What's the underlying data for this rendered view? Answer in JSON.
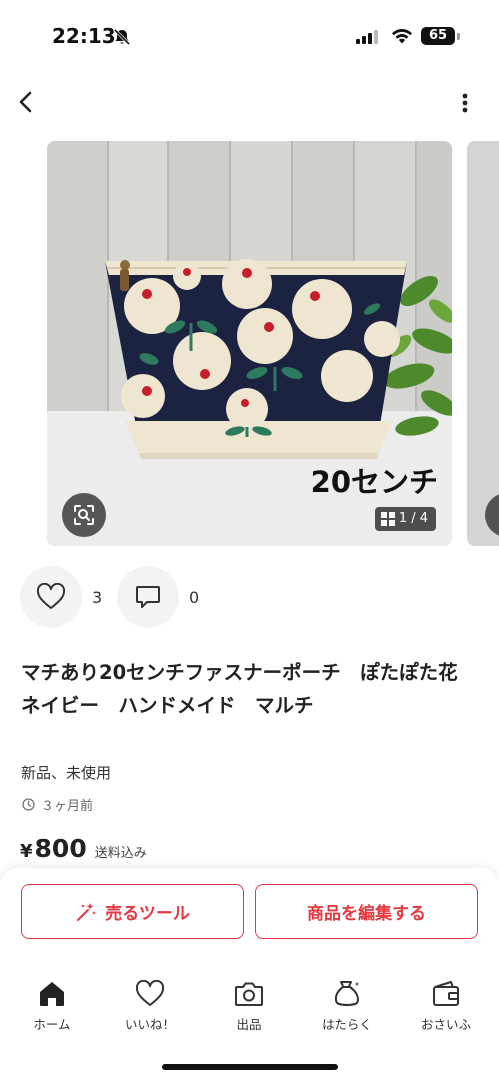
{
  "status_bar": {
    "time": "22:13",
    "battery": "65"
  },
  "product": {
    "image_overlay_text": "20センチ",
    "image_counter": "1 / 4",
    "likes": "3",
    "comments": "0",
    "title": "マチあり20センチファスナーポーチ　ぽたぽた花　ネイビー　ハンドメイド　マルチ",
    "condition": "新品、未使用",
    "posted": "３ヶ月前",
    "price_symbol": "¥",
    "price": "800",
    "shipping": "送料込み"
  },
  "actions": {
    "tools_label": "売るツール",
    "edit_label": "商品を編集する"
  },
  "tabs": [
    {
      "label": "ホーム",
      "icon": "home-icon"
    },
    {
      "label": "いいね！",
      "icon": "heart-icon"
    },
    {
      "label": "出品",
      "icon": "camera-icon"
    },
    {
      "label": "はたらく",
      "icon": "money-bag-icon"
    },
    {
      "label": "おさいふ",
      "icon": "wallet-icon"
    }
  ],
  "colors": {
    "accent": "#e6383f",
    "pouch_navy": "#1b2340",
    "flower_cream": "#efe6d2",
    "flower_red": "#c81e2a",
    "leaf_green": "#2e7a5e"
  }
}
